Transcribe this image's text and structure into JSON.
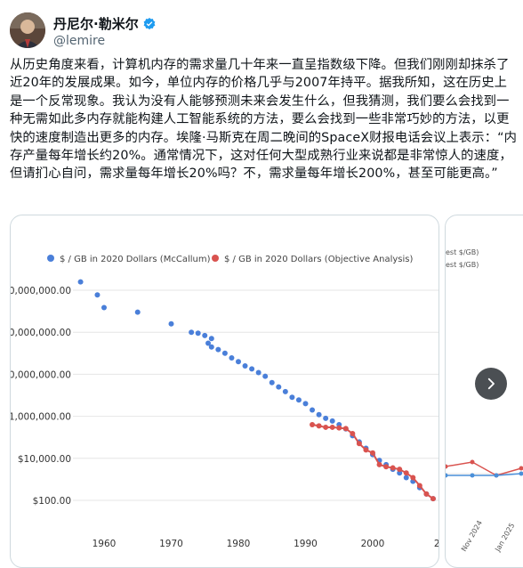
{
  "author": {
    "display_name": "丹尼尔·勒米尔",
    "handle": "@lemire",
    "verified": true
  },
  "tweet": {
    "text": "从历史角度来看，计算机内存的需求量几十年来一直呈指数级下降。但我们刚刚却抹杀了近20年的发展成果。如今，单位内存的价格几乎与2007年持平。据我所知，这在历史上是一个反常现象。我认为没有人能够预测未来会发生什么，但我猜测，我们要么会找到一种无需如此多内存就能构建人工智能系统的方法，要么会找到一些非常巧妙的方法，以更快的速度制造出更多的内存。埃隆·马斯克在周二晚间的SpaceX财报电话会议上表示：“内存产量每年增长约20%。通常情况下，这对任何大型成熟行业来说都是非常惊人的速度，但请扪心自问，需求量每年增长20%吗？不，需求量每年增长200%，甚至可能更高。”"
  },
  "chart_data": {
    "type": "scatter",
    "y_scale": "log",
    "grid": true,
    "legend_position": "top",
    "x_ticks": [
      "1960",
      "1970",
      "1980",
      "1990",
      "2000",
      "20"
    ],
    "y_ticks": [
      {
        "value": 100000000000,
        "label": "000,000,000.00"
      },
      {
        "value": 1000000000,
        "label": "000,000,000.00"
      },
      {
        "value": 10000000,
        "label": "00,000,000.00"
      },
      {
        "value": 100000,
        "label": "$1,000,000.00"
      },
      {
        "value": 1000,
        "label": "$10,000.00"
      },
      {
        "value": 10,
        "label": "$100.00"
      }
    ],
    "x_range": [
      1954,
      2010
    ],
    "series": [
      {
        "name": "$ / GB in 2020 Dollars (McCallum)",
        "color": "#4a7fd9",
        "points": [
          [
            1956.5,
            250000000000
          ],
          [
            1959,
            60000000000
          ],
          [
            1960,
            15000000000
          ],
          [
            1965,
            9000000000
          ],
          [
            1970,
            2500000000
          ],
          [
            1973,
            1000000000
          ],
          [
            1974,
            900000000
          ],
          [
            1975,
            700000000
          ],
          [
            1976,
            500000000
          ],
          [
            1975.5,
            300000000
          ],
          [
            1976,
            200000000
          ],
          [
            1977,
            150000000
          ],
          [
            1978,
            100000000
          ],
          [
            1979,
            60000000
          ],
          [
            1980,
            40000000
          ],
          [
            1981,
            25000000
          ],
          [
            1982,
            18000000
          ],
          [
            1983,
            12000000
          ],
          [
            1984,
            8000000
          ],
          [
            1985,
            4000000
          ],
          [
            1986,
            2500000
          ],
          [
            1987,
            1500000
          ],
          [
            1988,
            800000
          ],
          [
            1989,
            600000
          ],
          [
            1990,
            400000
          ],
          [
            1991,
            200000
          ],
          [
            1992,
            120000
          ],
          [
            1993,
            80000
          ],
          [
            1994,
            60000
          ],
          [
            1995,
            40000
          ],
          [
            1996,
            25000
          ],
          [
            1997,
            12000
          ],
          [
            1998,
            6000
          ],
          [
            1999,
            3000
          ],
          [
            2000,
            1500
          ],
          [
            2001,
            800
          ],
          [
            2002,
            500
          ],
          [
            2003,
            300
          ],
          [
            2004,
            200
          ],
          [
            2005,
            120
          ],
          [
            2006,
            80
          ],
          [
            2007,
            40
          ],
          [
            2008,
            20
          ],
          [
            2009,
            12
          ]
        ]
      },
      {
        "name": "$ / GB in 2020 Dollars (Objective Analysis)",
        "color": "#d9534f",
        "points": [
          [
            1991,
            40000
          ],
          [
            1992,
            35000
          ],
          [
            1993,
            30000
          ],
          [
            1994,
            30000
          ],
          [
            1995,
            28000
          ],
          [
            1996,
            26000
          ],
          [
            1997,
            15000
          ],
          [
            1998,
            5000
          ],
          [
            1999,
            2500
          ],
          [
            2000,
            1800
          ],
          [
            2001,
            500
          ],
          [
            2002,
            400
          ],
          [
            2003,
            350
          ],
          [
            2004,
            300
          ],
          [
            2005,
            200
          ],
          [
            2006,
            120
          ],
          [
            2007,
            50
          ],
          [
            2008,
            20
          ],
          [
            2009,
            12
          ]
        ]
      }
    ]
  },
  "chart2_legend": [
    "est $/GB)",
    "est $/GB)"
  ],
  "chart2_x_ticks": [
    "Nov 2024",
    "Jan 2025"
  ],
  "next_button": {
    "icon": "chevron-right-icon"
  }
}
